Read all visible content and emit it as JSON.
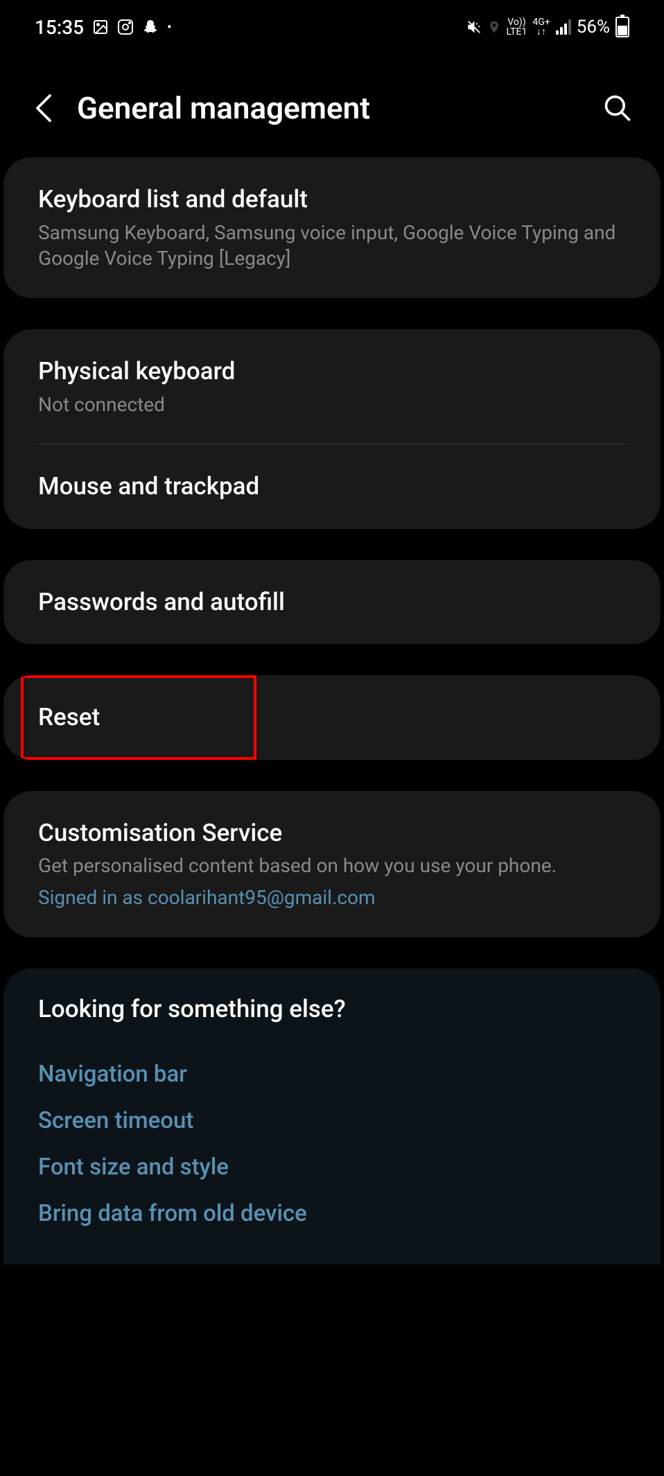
{
  "status": {
    "time": "15:35",
    "battery": "56%",
    "network1": "Vo))",
    "network1b": "LTE1",
    "network2": "4G+",
    "network2b": "↓↑"
  },
  "header": {
    "title": "General management"
  },
  "items": {
    "keyboard_list": {
      "title": "Keyboard list and default",
      "subtitle": "Samsung Keyboard, Samsung voice input, Google Voice Typing and Google Voice Typing [Legacy]"
    },
    "physical_keyboard": {
      "title": "Physical keyboard",
      "subtitle": "Not connected"
    },
    "mouse_trackpad": {
      "title": "Mouse and trackpad"
    },
    "passwords": {
      "title": "Passwords and autofill"
    },
    "reset": {
      "title": "Reset"
    },
    "customisation": {
      "title": "Customisation Service",
      "subtitle": "Get personalised content based on how you use your phone.",
      "link": "Signed in as coolarihant95@gmail.com"
    }
  },
  "footer": {
    "title": "Looking for something else?",
    "links": {
      "nav_bar": "Navigation bar",
      "screen_timeout": "Screen timeout",
      "font_size": "Font size and style",
      "bring_data": "Bring data from old device"
    }
  }
}
